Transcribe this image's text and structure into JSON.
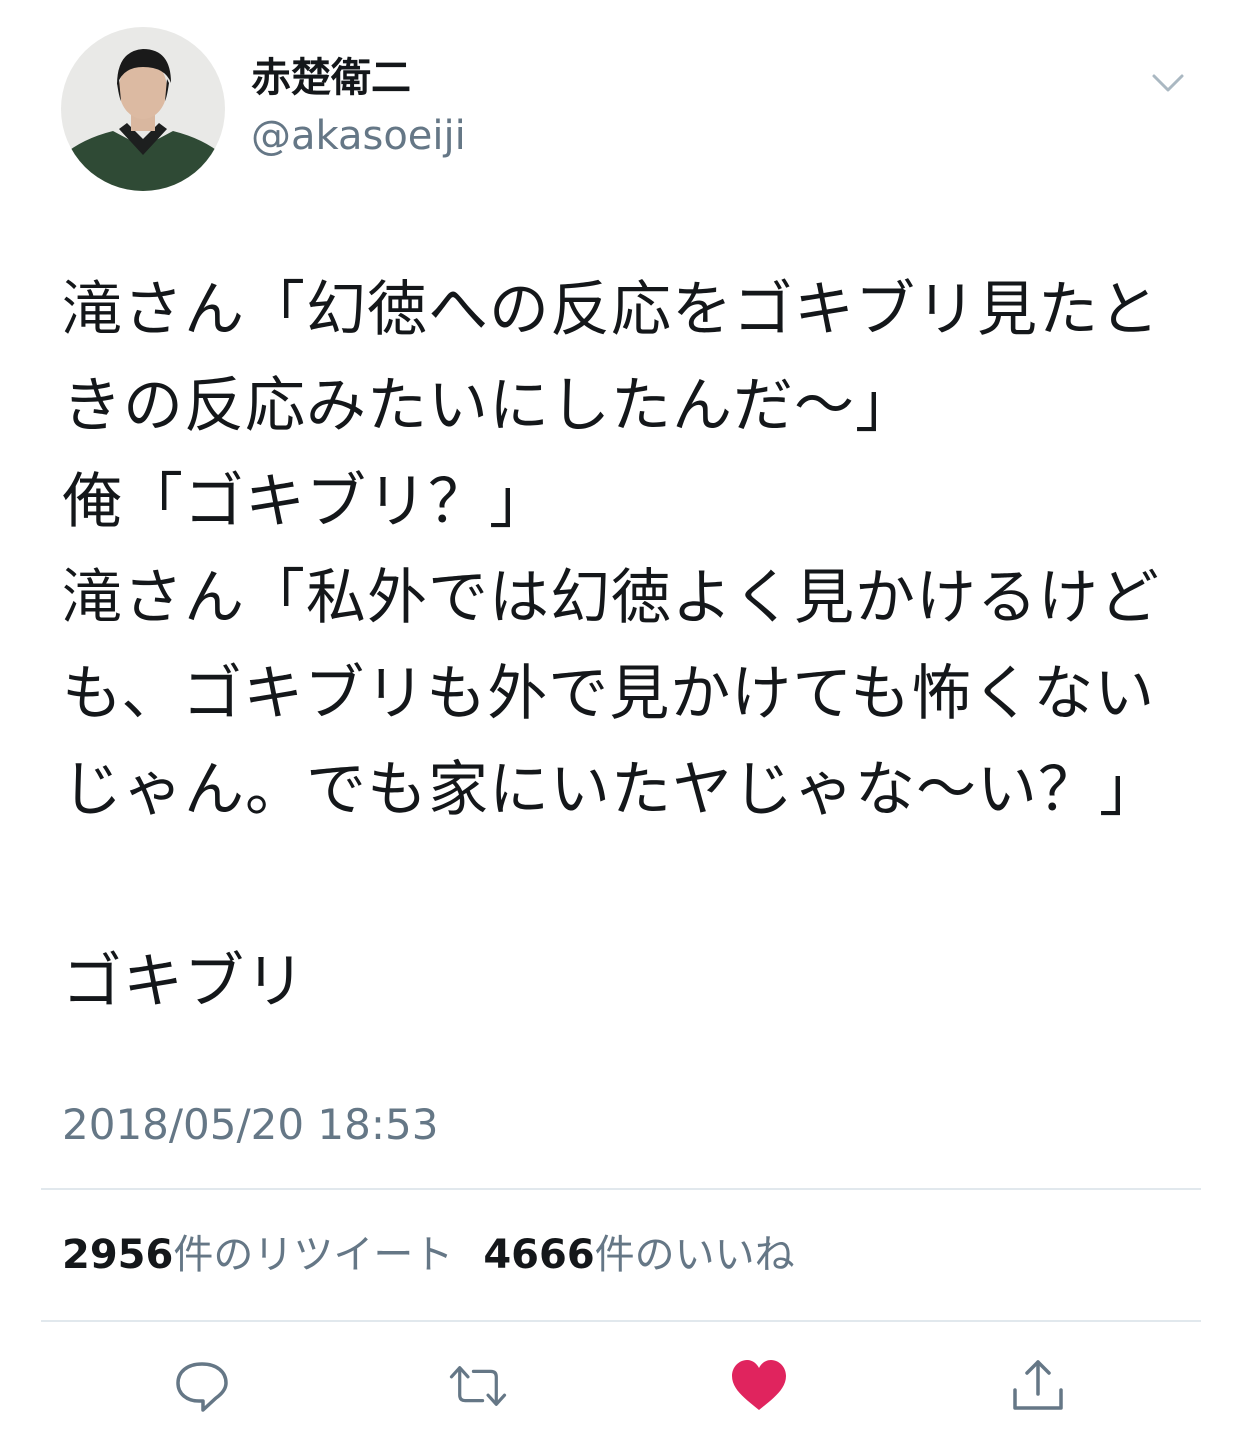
{
  "user": {
    "display_name": "赤楚衛二",
    "handle": "@akasoeiji"
  },
  "tweet": {
    "text": "滝さん「幻徳への反応をゴキブリ見たときの反応みたいにしたんだ〜」\n俺「ゴキブリ？」\n滝さん「私外では幻徳よく見かけるけども、ゴキブリも外で見かけても怖くないじゃん。でも家にいたヤじゃな〜い？」\n\nゴキブリ",
    "timestamp": "2018/05/20 18:53"
  },
  "stats": {
    "retweet_count": "2956",
    "retweet_label": "件のリツイート",
    "like_count": "4666",
    "like_label": "件のいいね"
  },
  "actions": {
    "reply_icon": "reply-icon",
    "retweet_icon": "retweet-icon",
    "like_icon": "heart-icon",
    "share_icon": "share-icon"
  },
  "colors": {
    "text": "#14171a",
    "secondary": "#657786",
    "divider": "#e1e8ed",
    "like_active": "#e0245e"
  }
}
